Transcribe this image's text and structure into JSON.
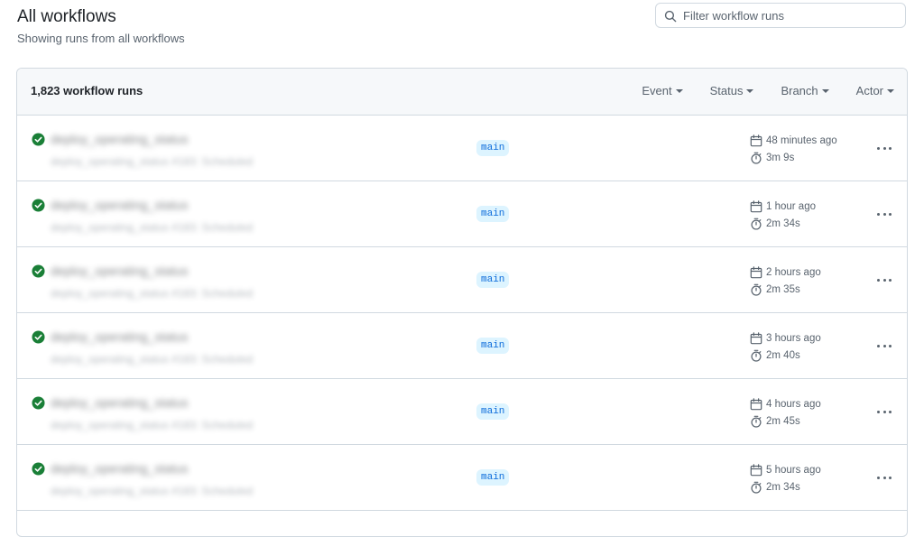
{
  "header": {
    "title": "All workflows",
    "subtitle": "Showing runs from all workflows"
  },
  "search": {
    "placeholder": "Filter workflow runs",
    "value": ""
  },
  "runs_header": {
    "count_label": "1,823 workflow runs",
    "filters": [
      "Event",
      "Status",
      "Branch",
      "Actor"
    ]
  },
  "colors": {
    "success": "#1a7f37",
    "branch_bg": "#ddf4ff",
    "branch_fg": "#0969da"
  },
  "runs": [
    {
      "status": "success",
      "title": "(blurred)",
      "subtitle": "(blurred)",
      "branch": "main",
      "time": "48 minutes ago",
      "duration": "3m 9s"
    },
    {
      "status": "success",
      "title": "(blurred)",
      "subtitle": "(blurred)",
      "branch": "main",
      "time": "1 hour ago",
      "duration": "2m 34s"
    },
    {
      "status": "success",
      "title": "(blurred)",
      "subtitle": "(blurred)",
      "branch": "main",
      "time": "2 hours ago",
      "duration": "2m 35s"
    },
    {
      "status": "success",
      "title": "(blurred)",
      "subtitle": "(blurred)",
      "branch": "main",
      "time": "3 hours ago",
      "duration": "2m 40s"
    },
    {
      "status": "success",
      "title": "(blurred)",
      "subtitle": "(blurred)",
      "branch": "main",
      "time": "4 hours ago",
      "duration": "2m 45s"
    },
    {
      "status": "success",
      "title": "(blurred)",
      "subtitle": "(blurred)",
      "branch": "main",
      "time": "5 hours ago",
      "duration": "2m 34s"
    }
  ]
}
